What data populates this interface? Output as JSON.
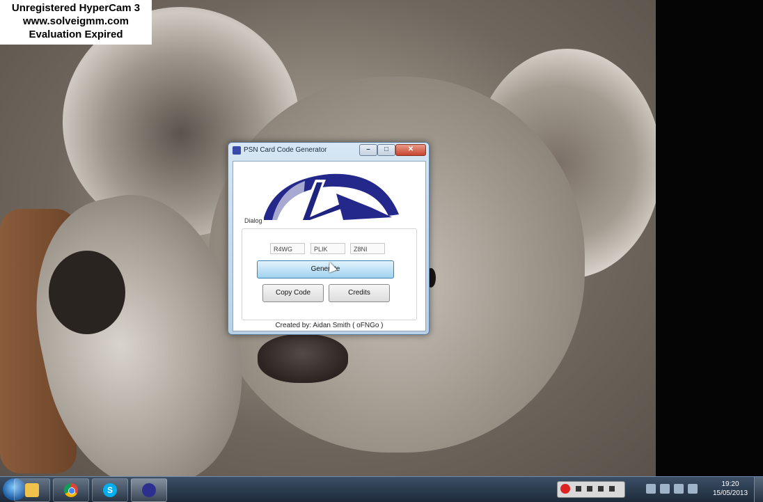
{
  "watermark": {
    "line1": "Unregistered HyperCam 3",
    "line2": "www.solveigmm.com",
    "line3": "Evaluation Expired"
  },
  "window": {
    "title": "PSN Card Code Generator",
    "group_label": "Dialog",
    "code_fields": [
      "R4WG",
      "PLIK",
      "Z8NI"
    ],
    "generate_label": "Generate",
    "copy_code_label": "Copy Code",
    "credits_label": "Credits",
    "footer": "Created by: Aidan Smith ( oFNGo )"
  },
  "taskbar": {
    "apps": [
      {
        "name": "folder-icon"
      },
      {
        "name": "chrome-icon"
      },
      {
        "name": "skype-icon",
        "glyph": "S"
      },
      {
        "name": "psn-generator-icon"
      }
    ],
    "time": "19:20",
    "date": "15/05/2013"
  },
  "colors": {
    "generate_button": "#9fd2ef",
    "close_button": "#c6442d",
    "psn_logo_blue": "#23288a"
  }
}
